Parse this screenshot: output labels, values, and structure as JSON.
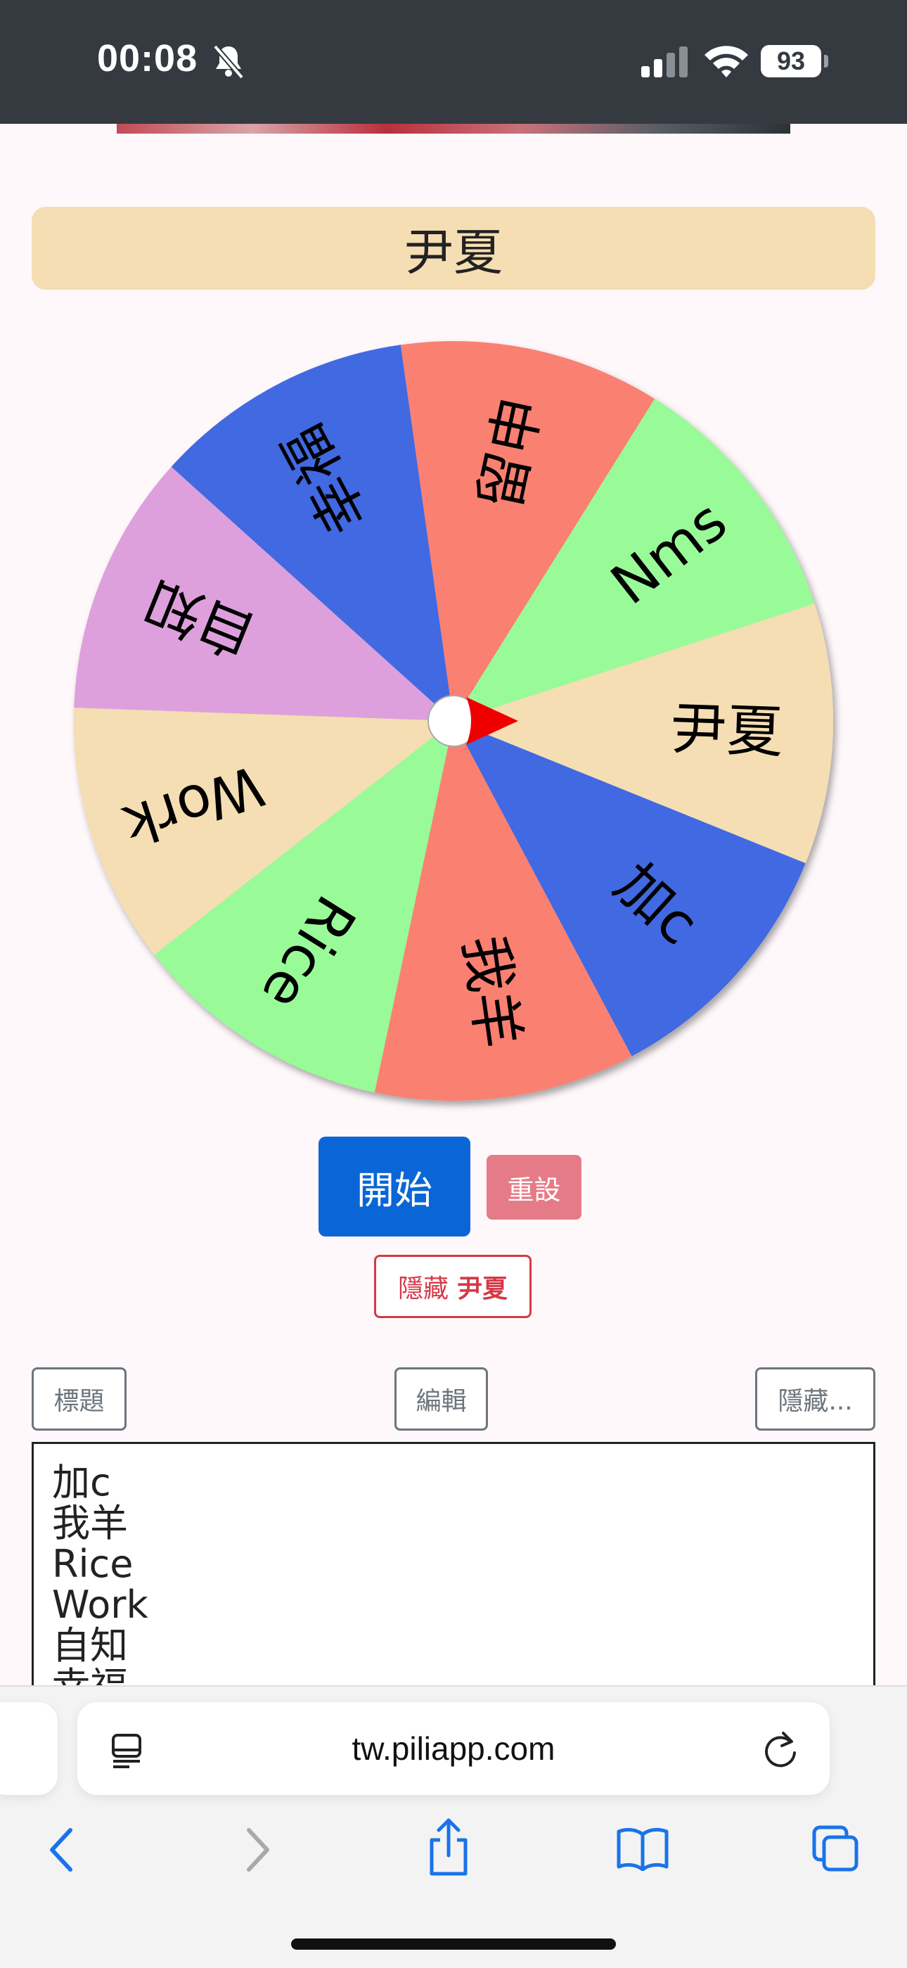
{
  "status": {
    "time": "00:08",
    "battery": "93"
  },
  "title": "尹夏",
  "wheel": {
    "segments": [
      {
        "label": "尹夏",
        "color": "#f5deb3"
      },
      {
        "label": "加c",
        "color": "#4169e1"
      },
      {
        "label": "我羊",
        "color": "#fa8072"
      },
      {
        "label": "Rice",
        "color": "#98fb98"
      },
      {
        "label": "Work",
        "color": "#f5deb3"
      },
      {
        "label": "自知",
        "color": "#dda0dd"
      },
      {
        "label": "幸福",
        "color": "#4169e1"
      },
      {
        "label": "留申",
        "color": "#fa8072"
      },
      {
        "label": "Nms",
        "color": "#98fb98"
      }
    ],
    "pointer_color": "#ee0000"
  },
  "buttons": {
    "start": "開始",
    "reset": "重設",
    "hide_prefix": "隱藏",
    "hide_name": "尹夏",
    "title_toggle": "標題",
    "edit": "編輯",
    "hidden_list": "隱藏..."
  },
  "entries": [
    "加c",
    "我羊",
    "Rice",
    "Work",
    "自知",
    "幸福"
  ],
  "browser": {
    "url": "tw.piliapp.com"
  }
}
